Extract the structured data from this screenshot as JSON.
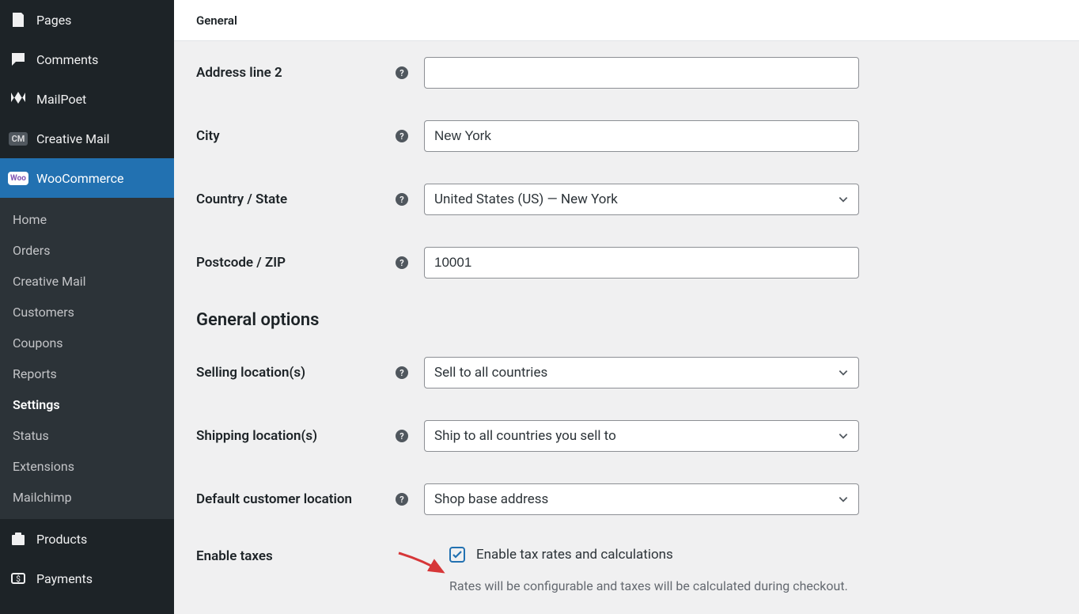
{
  "sidebar": {
    "pages": "Pages",
    "comments": "Comments",
    "mailpoet": "MailPoet",
    "creative_mail": "Creative Mail",
    "woocommerce": "WooCommerce",
    "products": "Products",
    "payments": "Payments"
  },
  "submenu": {
    "home": "Home",
    "orders": "Orders",
    "creative_mail": "Creative Mail",
    "customers": "Customers",
    "coupons": "Coupons",
    "reports": "Reports",
    "settings": "Settings",
    "status": "Status",
    "extensions": "Extensions",
    "mailchimp": "Mailchimp"
  },
  "topbar": {
    "tab": "General"
  },
  "form": {
    "address2": {
      "label": "Address line 2",
      "value": ""
    },
    "city": {
      "label": "City",
      "value": "New York"
    },
    "country": {
      "label": "Country / State",
      "value": "United States (US) — New York"
    },
    "postcode": {
      "label": "Postcode / ZIP",
      "value": "10001"
    },
    "section_heading": "General options",
    "selling": {
      "label": "Selling location(s)",
      "value": "Sell to all countries"
    },
    "shipping": {
      "label": "Shipping location(s)",
      "value": "Ship to all countries you sell to"
    },
    "default_loc": {
      "label": "Default customer location",
      "value": "Shop base address"
    },
    "taxes": {
      "label": "Enable taxes",
      "checkbox_label": "Enable tax rates and calculations",
      "help": "Rates will be configurable and taxes will be calculated during checkout."
    }
  },
  "icons": {
    "cm_badge": "CM",
    "woo_badge": "Woo"
  }
}
